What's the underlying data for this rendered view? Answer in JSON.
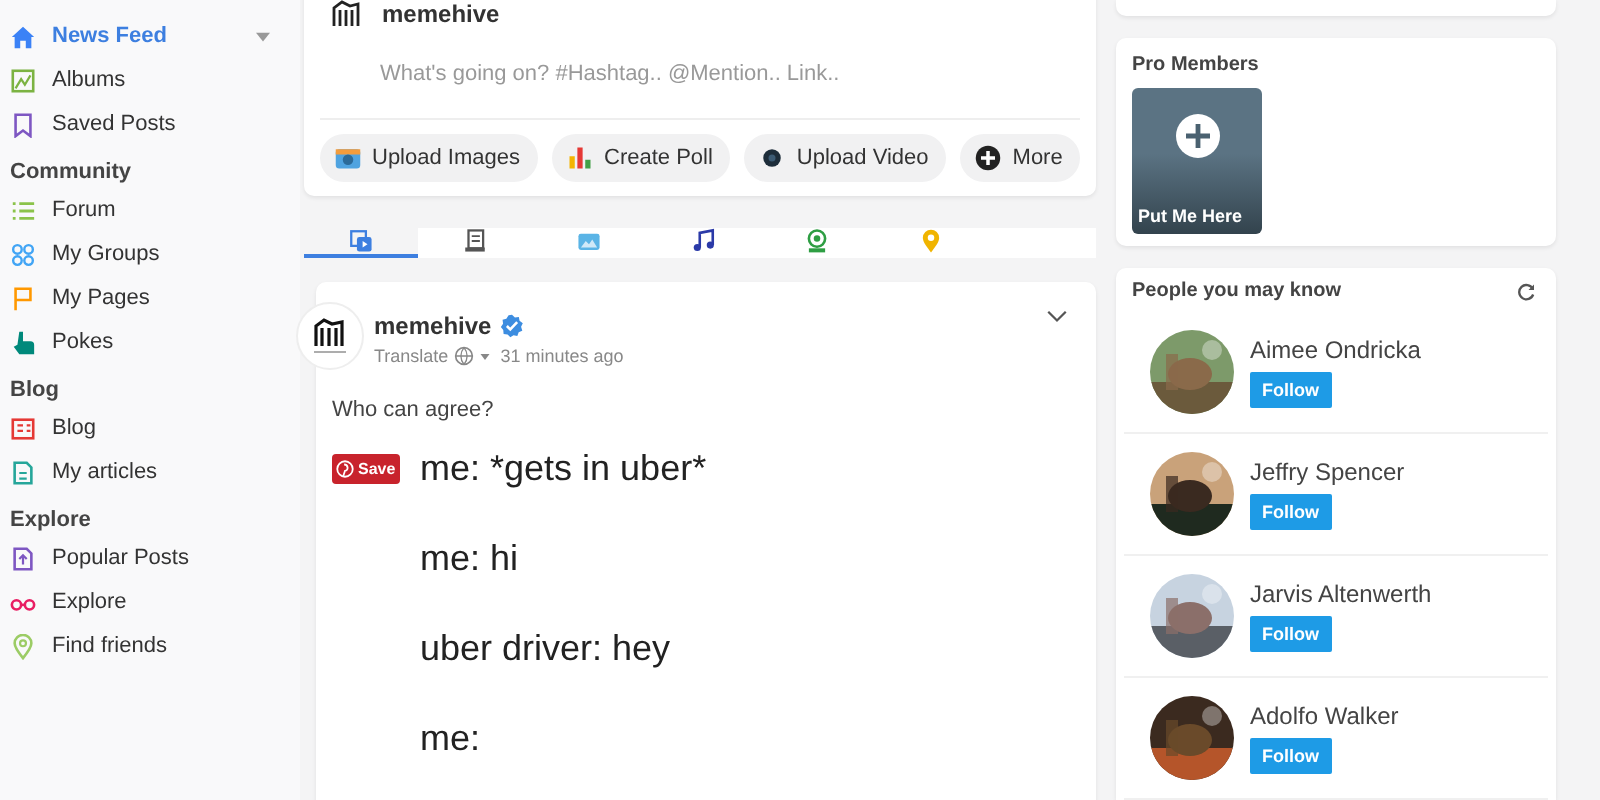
{
  "sidebar": {
    "sections": [
      {
        "items": [
          {
            "label": "News Feed",
            "selected": true,
            "expandable": true
          },
          {
            "label": "Albums",
            "selected": false
          },
          {
            "label": "Saved Posts",
            "selected": false
          }
        ]
      },
      {
        "title": "Community",
        "items": [
          {
            "label": "Forum",
            "selected": false
          },
          {
            "label": "My Groups",
            "selected": false
          },
          {
            "label": "My Pages",
            "selected": false
          },
          {
            "label": "Pokes",
            "selected": false
          }
        ]
      },
      {
        "title": "Blog",
        "items": [
          {
            "label": "Blog",
            "selected": false
          },
          {
            "label": "My articles",
            "selected": false
          }
        ]
      },
      {
        "title": "Explore",
        "items": [
          {
            "label": "Popular Posts",
            "selected": false
          },
          {
            "label": "Explore",
            "selected": false
          },
          {
            "label": "Find friends",
            "selected": false
          }
        ]
      }
    ]
  },
  "composer": {
    "user": "memehive",
    "placeholder": "What's going on? #Hashtag.. @Mention.. Link..",
    "actions": [
      "Upload Images",
      "Create Poll",
      "Upload Video",
      "More"
    ]
  },
  "post_tabs": [
    {
      "selected": true
    },
    {
      "selected": false
    },
    {
      "selected": false
    },
    {
      "selected": false
    },
    {
      "selected": false
    },
    {
      "selected": false
    }
  ],
  "post": {
    "author": "memehive",
    "verified": true,
    "translate": "Translate",
    "time": "31 minutes ago",
    "caption": "Who can agree?",
    "save_label": "Save",
    "lines": [
      "me: *gets in uber*",
      "me: hi",
      "uber driver: hey",
      "me:"
    ]
  },
  "pro_members": {
    "title": "Pro Members",
    "tile_label": "Put Me Here"
  },
  "people": {
    "title": "People you may know",
    "list": [
      {
        "name": "Aimee Ondricka",
        "button": "Follow"
      },
      {
        "name": "Jeffry Spencer",
        "button": "Follow"
      },
      {
        "name": "Jarvis Altenwerth",
        "button": "Follow"
      },
      {
        "name": "Adolfo Walker",
        "button": "Follow"
      }
    ]
  }
}
